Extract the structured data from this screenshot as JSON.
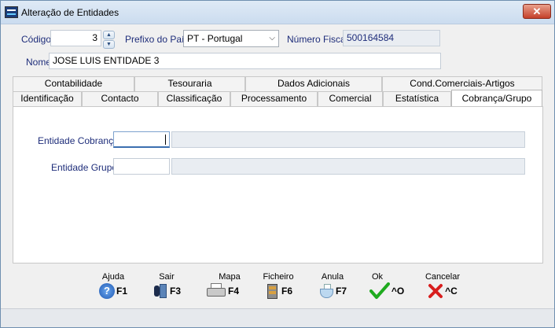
{
  "window": {
    "title": "Alteração de Entidades",
    "close_label": "✕"
  },
  "header": {
    "codigo_label": "Código",
    "codigo_value": "3",
    "prefixo_label": "Prefixo do País",
    "prefixo_value": "PT - Portugal",
    "nif_label": "Número Fiscal",
    "nif_value": "500164584",
    "nome_label": "Nome",
    "nome_value": "JOSE LUIS ENTIDADE 3"
  },
  "tabs_row1": [
    {
      "label": "Contabilidade"
    },
    {
      "label": "Tesouraria"
    },
    {
      "label": "Dados Adicionais"
    },
    {
      "label": "Cond.Comerciais-Artigos"
    }
  ],
  "tabs_row2": [
    {
      "label": "Identificação"
    },
    {
      "label": "Contacto"
    },
    {
      "label": "Classificação"
    },
    {
      "label": "Processamento"
    },
    {
      "label": "Comercial"
    },
    {
      "label": "Estatística"
    },
    {
      "label": "Cobrança/Grupo"
    }
  ],
  "active_tab": "Cobrança/Grupo",
  "panel": {
    "entidade_cobranca_label": "Entidade Cobrança",
    "entidade_cobranca_value": "",
    "entidade_cobranca_desc": "",
    "entidade_grupo_label": "Entidade Grupo",
    "entidade_grupo_value": "",
    "entidade_grupo_desc": ""
  },
  "footer_buttons": [
    {
      "label": "Ajuda",
      "key": "F1",
      "icon": "help-icon"
    },
    {
      "label": "Sair",
      "key": "F3",
      "icon": "exit-icon"
    },
    {
      "label": "Mapa",
      "key": "F4",
      "icon": "printer-icon"
    },
    {
      "label": "Ficheiro",
      "key": "F6",
      "icon": "file-cabinet-icon"
    },
    {
      "label": "Anula",
      "key": "F7",
      "icon": "annul-icon"
    },
    {
      "label": "Ok",
      "key": "^O",
      "icon": "checkmark-icon"
    },
    {
      "label": "Cancelar",
      "key": "^C",
      "icon": "red-x-icon"
    }
  ],
  "colors": {
    "label_text": "#1e2d7a",
    "ok_green": "#1faa1f",
    "cancel_red": "#d81e1e"
  }
}
